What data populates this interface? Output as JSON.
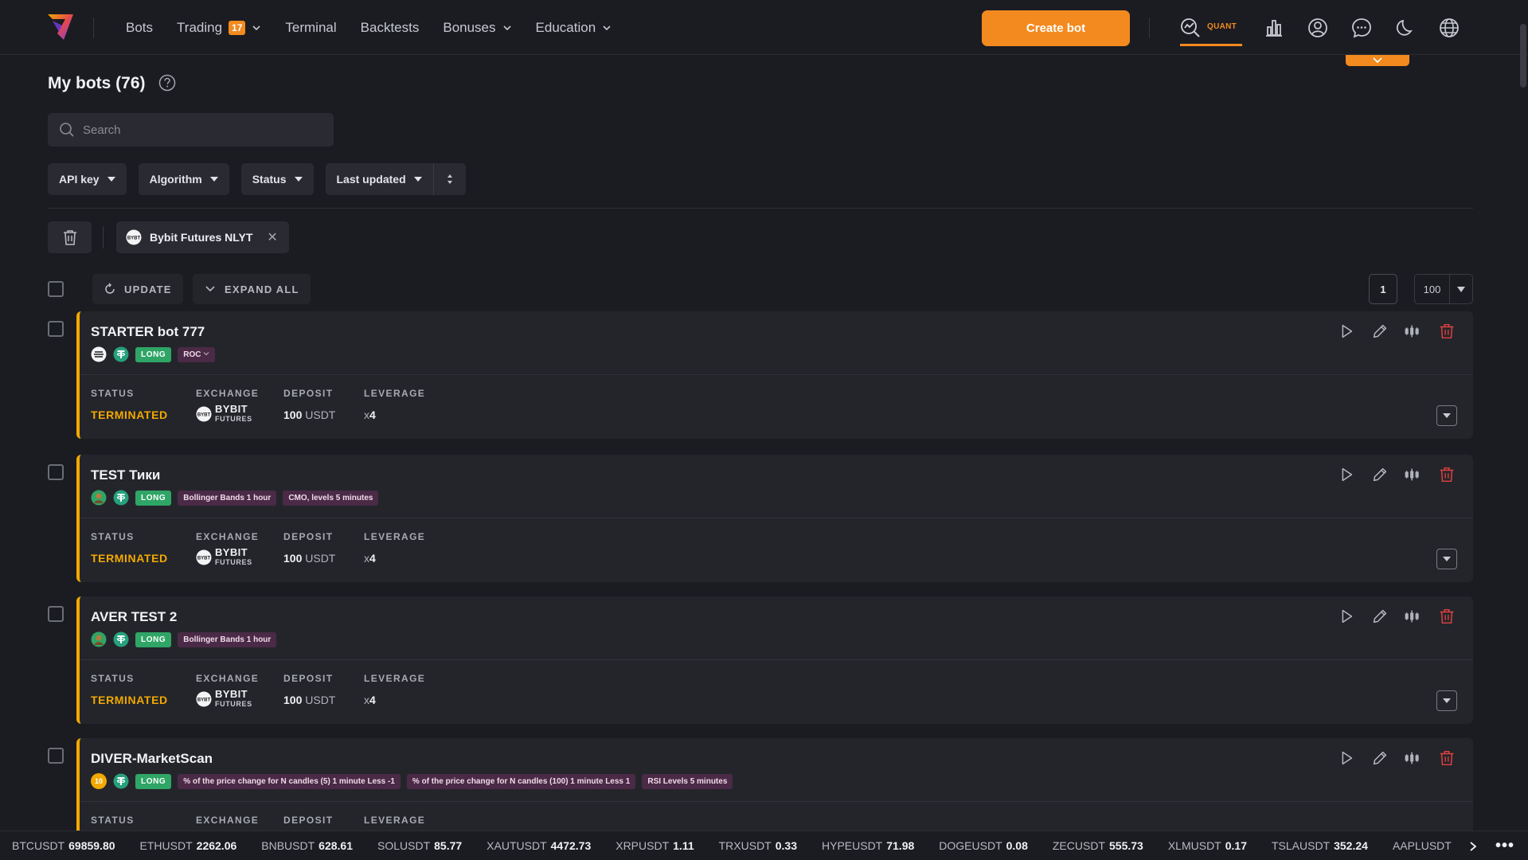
{
  "nav": {
    "items": [
      {
        "label": "Bots",
        "badge": null,
        "has_dropdown": false
      },
      {
        "label": "Trading",
        "badge": "17",
        "has_dropdown": true
      },
      {
        "label": "Terminal",
        "badge": null,
        "has_dropdown": false
      },
      {
        "label": "Backtests",
        "badge": null,
        "has_dropdown": false
      },
      {
        "label": "Bonuses",
        "badge": null,
        "has_dropdown": true
      },
      {
        "label": "Education",
        "badge": null,
        "has_dropdown": true
      }
    ],
    "create_label": "Create bot",
    "quant_label": "QUANT",
    "icons": [
      "quant-icon",
      "stats-icon",
      "profile-icon",
      "chat-icon",
      "moon-icon",
      "globe-icon"
    ]
  },
  "colors": {
    "accent": "#f28a1f",
    "status_terminated": "#f2a900",
    "long": "#2fa566",
    "indicator_tag": "#4a2a46"
  },
  "page": {
    "title": "My bots (76)",
    "search_placeholder": "Search",
    "filters": [
      "API key",
      "Algorithm",
      "Status"
    ],
    "sort_label": "Last updated",
    "active_chip": "Bybit Futures NLYT",
    "update_label": "UPDATE",
    "expand_all_label": "EXPAND ALL",
    "page_number": "1",
    "per_page": "100"
  },
  "columns": {
    "status": "STATUS",
    "exchange": "EXCHANGE",
    "deposit": "DEPOSIT",
    "leverage": "LEVERAGE"
  },
  "bots": [
    {
      "name": "STARTER bot 777",
      "icon": "stripes-icon",
      "direction": "LONG",
      "indicators": [
        "ROC"
      ],
      "indicator_dropdown": true,
      "status": "TERMINATED",
      "exchange": "BYBIT",
      "exchange_sub": "FUTURES",
      "deposit": "100",
      "deposit_unit": "USDT",
      "leverage_prefix": "x",
      "leverage": "4"
    },
    {
      "name": "TEST Тики",
      "icon": "avatar-green-icon",
      "direction": "LONG",
      "indicators": [
        "Bollinger Bands 1 hour",
        "CMO, levels 5 minutes"
      ],
      "indicator_dropdown": false,
      "status": "TERMINATED",
      "exchange": "BYBIT",
      "exchange_sub": "FUTURES",
      "deposit": "100",
      "deposit_unit": "USDT",
      "leverage_prefix": "x",
      "leverage": "4"
    },
    {
      "name": "AVER TEST 2",
      "icon": "avatar-green-icon",
      "direction": "LONG",
      "indicators": [
        "Bollinger Bands 1 hour"
      ],
      "indicator_dropdown": false,
      "status": "TERMINATED",
      "exchange": "BYBIT",
      "exchange_sub": "FUTURES",
      "deposit": "100",
      "deposit_unit": "USDT",
      "leverage_prefix": "x",
      "leverage": "4"
    },
    {
      "name": "DIVER-MarketScan",
      "icon": "badge-10-icon",
      "icon_text": "10",
      "direction": "LONG",
      "indicators": [
        "% of the price change for N candles (5) 1 minute Less -1",
        "% of the price change for N candles (100) 1 minute Less 1",
        "RSI Levels 5 minutes"
      ],
      "indicator_dropdown": false,
      "status": "",
      "exchange": "",
      "exchange_sub": "",
      "deposit": "",
      "deposit_unit": "",
      "leverage_prefix": "",
      "leverage": ""
    }
  ],
  "ticker": [
    {
      "symbol": "BTCUSDT",
      "price": "69859.80"
    },
    {
      "symbol": "ETHUSDT",
      "price": "2262.06"
    },
    {
      "symbol": "BNBUSDT",
      "price": "628.61"
    },
    {
      "symbol": "SOLUSDT",
      "price": "85.77"
    },
    {
      "symbol": "XAUTUSDT",
      "price": "4472.73"
    },
    {
      "symbol": "XRPUSDT",
      "price": "1.11"
    },
    {
      "symbol": "TRXUSDT",
      "price": "0.33"
    },
    {
      "symbol": "HYPEUSDT",
      "price": "71.98"
    },
    {
      "symbol": "DOGEUSDT",
      "price": "0.08"
    },
    {
      "symbol": "ZECUSDT",
      "price": "555.73"
    },
    {
      "symbol": "XLMUSDT",
      "price": "0.17"
    },
    {
      "symbol": "TSLAUSDT",
      "price": "352.24"
    },
    {
      "symbol": "AAPLUSDT",
      "price": ""
    }
  ],
  "ticker_more": "•••"
}
